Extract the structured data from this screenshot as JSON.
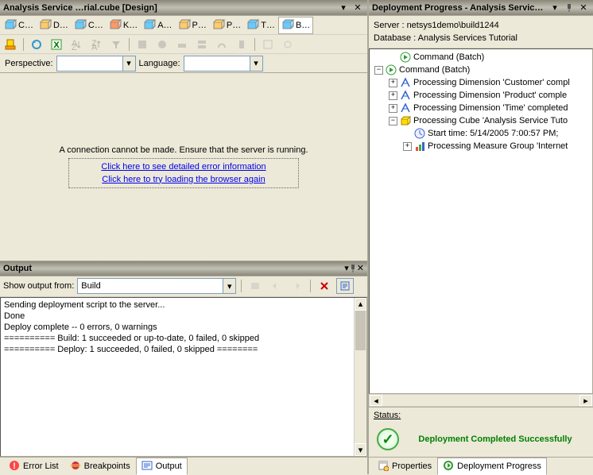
{
  "left": {
    "title": "Analysis Service …rial.cube [Design]",
    "tabs": [
      "C…",
      "D…",
      "C…",
      "K…",
      "A…",
      "P…",
      "P…",
      "T…",
      "B…"
    ],
    "activeTab": 8,
    "perspective_label": "Perspective:",
    "language_label": "Language:",
    "error_msg": "A connection cannot be made. Ensure that the server is running.",
    "link1": "Click here to see detailed error information",
    "link2": "Click here to try loading the browser again"
  },
  "output": {
    "title": "Output",
    "show_label": "Show output from:",
    "show_value": "Build",
    "lines": [
      "Sending deployment script to the server...",
      "Done",
      "Deploy complete -- 0 errors, 0 warnings",
      "========== Build: 1 succeeded or up-to-date, 0 failed, 0 skipped",
      "========== Deploy: 1 succeeded, 0 failed, 0 skipped ========"
    ]
  },
  "bottom_tabs_left": [
    {
      "label": "Error List",
      "active": false
    },
    {
      "label": "Breakpoints",
      "active": false
    },
    {
      "label": "Output",
      "active": true
    }
  ],
  "right": {
    "title": "Deployment Progress - Analysis Servic…",
    "server_line": "Server : netsys1demo\\build1244",
    "db_line": "Database : Analysis Services Tutorial",
    "tree": [
      {
        "indent": 1,
        "toggle": "",
        "icon": "play",
        "text": "Command (Batch)"
      },
      {
        "indent": 0,
        "toggle": "-",
        "icon": "play",
        "text": "Command (Batch)"
      },
      {
        "indent": 1,
        "toggle": "+",
        "icon": "dim",
        "text": "Processing Dimension 'Customer' compl"
      },
      {
        "indent": 1,
        "toggle": "+",
        "icon": "dim",
        "text": "Processing Dimension 'Product' comple"
      },
      {
        "indent": 1,
        "toggle": "+",
        "icon": "dim",
        "text": "Processing Dimension 'Time' completed"
      },
      {
        "indent": 1,
        "toggle": "-",
        "icon": "cube",
        "text": "Processing Cube 'Analysis Service Tuto"
      },
      {
        "indent": 2,
        "toggle": "",
        "icon": "clock",
        "text": "Start time: 5/14/2005 7:00:57 PM;"
      },
      {
        "indent": 2,
        "toggle": "+",
        "icon": "measure",
        "text": "Processing Measure Group 'Internet"
      }
    ],
    "status_label": "Status:",
    "status_text": "Deployment Completed Successfully"
  },
  "bottom_tabs_right": [
    {
      "label": "Properties",
      "active": false
    },
    {
      "label": "Deployment Progress",
      "active": true
    }
  ]
}
